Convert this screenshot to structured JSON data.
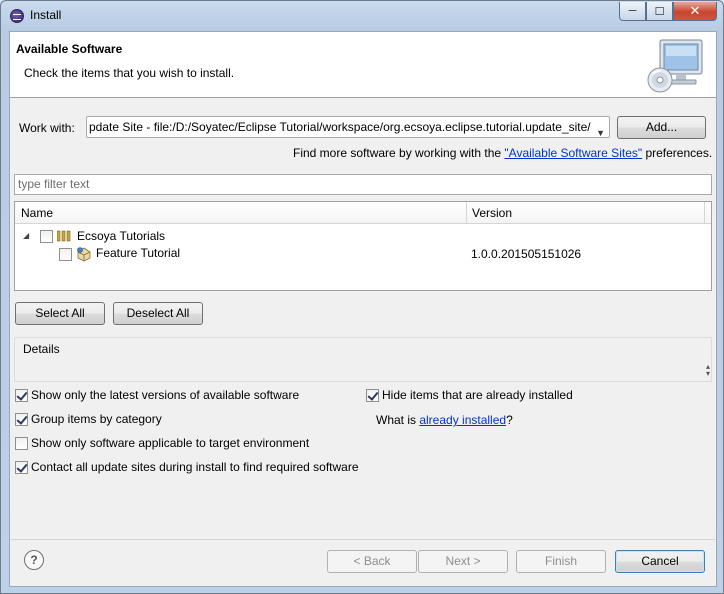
{
  "window": {
    "title": "Install",
    "minimize": "─",
    "maximize": "☐",
    "close": "✕"
  },
  "banner": {
    "title": "Available Software",
    "subtitle": "Check the items that you wish to install."
  },
  "work_with": {
    "label": "Work with:",
    "value": "pdate Site - file:/D:/Soyatec/Eclipse Tutorial/workspace/org.ecsoya.eclipse.tutorial.update_site/",
    "add_button": "Add...",
    "find_more_prefix": "Find more software by working with the ",
    "find_more_link": "\"Available Software Sites\"",
    "find_more_suffix": " preferences."
  },
  "filter": {
    "placeholder": "type filter text"
  },
  "table": {
    "columns": [
      "Name",
      "Version"
    ],
    "rows": [
      {
        "name": "Ecsoya Tutorials",
        "version": "",
        "checked": false,
        "expanded": true
      },
      {
        "name": "Feature Tutorial",
        "version": "1.0.0.201505151026",
        "checked": false
      }
    ]
  },
  "buttons": {
    "select_all": "Select All",
    "deselect_all": "Deselect All",
    "back": "< Back",
    "next": "Next >",
    "finish": "Finish",
    "cancel": "Cancel"
  },
  "details": {
    "label": "Details"
  },
  "options": {
    "latest_versions": {
      "label": "Show only the latest versions of available software",
      "checked": true
    },
    "group_by_category": {
      "label": "Group items by category",
      "checked": true
    },
    "applicable_only": {
      "label": "Show only software applicable to target environment",
      "checked": false
    },
    "contact_all": {
      "label": "Contact all update sites during install to find required software",
      "checked": true
    },
    "hide_installed": {
      "label": "Hide items that are already installed",
      "checked": true
    },
    "what_is_prefix": "What is ",
    "what_is_link": "already installed",
    "what_is_suffix": "?"
  },
  "help": {
    "glyph": "?"
  }
}
